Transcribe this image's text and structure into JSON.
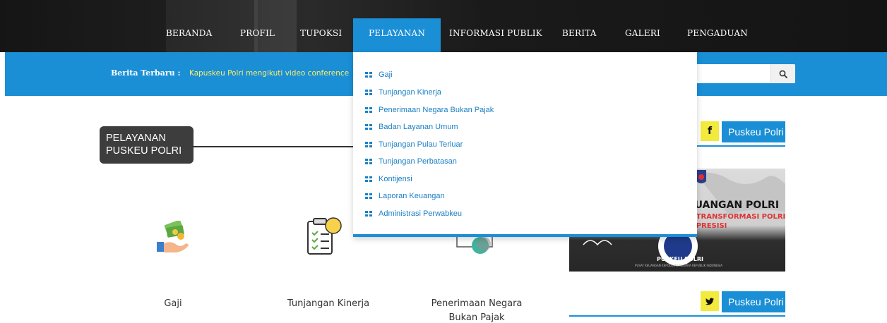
{
  "nav": {
    "items": [
      "BERANDA",
      "PROFIL",
      "TUPOKSI",
      "PELAYANAN",
      "INFORMASI PUBLIK",
      "BERITA",
      "GALERI",
      "PENGADUAN"
    ],
    "active": "PELAYANAN"
  },
  "ticker": {
    "label": "Berita Terbaru :",
    "text": "Kapuskeu Polri mengikuti video conference"
  },
  "search": {
    "icon": "search-icon"
  },
  "section": {
    "title_line1": "PELAYANAN",
    "title_line2": "PUSKEU POLRI"
  },
  "services": [
    {
      "label_line1": "Gaji",
      "label_line2": "",
      "icon": "money-hand-icon"
    },
    {
      "label_line1": "Tunjangan Kinerja",
      "label_line2": "",
      "icon": "clipboard-check-icon"
    },
    {
      "label_line1": "Penerimaan Negara",
      "label_line2": "Bukan Pajak",
      "icon": "tax-icon"
    }
  ],
  "dropdown": {
    "items": [
      "Gaji",
      "Tunjangan Kinerja",
      "Penerimaan Negara Bukan Pajak",
      "Badan Layanan Umum",
      "Tunjangan Pulau Terluar",
      "Tunjangan Perbatasan",
      "Kontijensi",
      "Laporan Keuangan",
      "Administrasi Perwabkeu"
    ]
  },
  "sidebar": {
    "facebook": {
      "icon_text": "f",
      "label": "Puskeu Polri"
    },
    "twitter": {
      "icon_text": "🐦",
      "label": "Puskeu Polri"
    },
    "banner": {
      "line1": "EUANGAN POLRI",
      "line2": "G TRANSFORMASI POLRI",
      "line3": "G PRESISI",
      "footer": "PUSKEU POLRI",
      "footer_sub": "PUSAT KEUANGAN KEPOLISIAN NEGARA REPUBLIK INDONESIA"
    }
  },
  "colors": {
    "accent": "#1a8fd6",
    "nav_bg": "#1a1a1a",
    "ticker_text": "#ffee66",
    "social_square": "#f2ea3c"
  }
}
